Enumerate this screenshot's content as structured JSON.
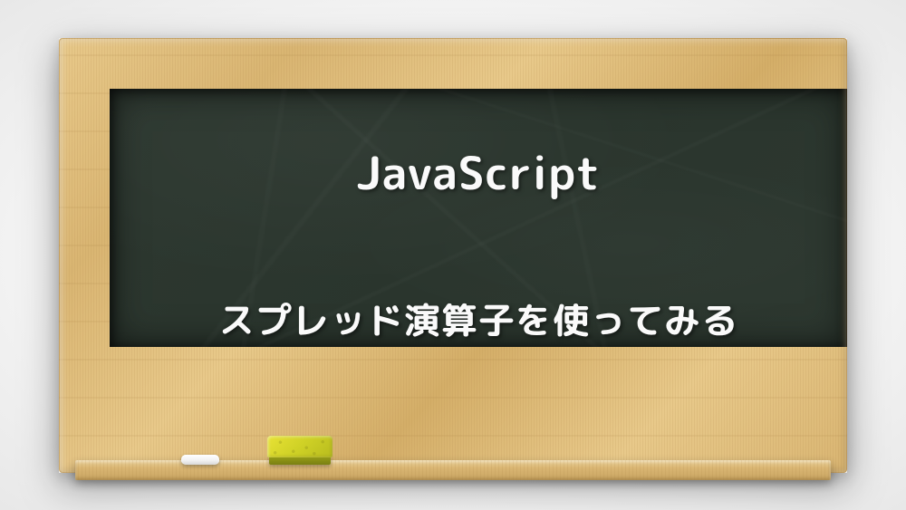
{
  "board": {
    "title": "JavaScript",
    "subtitle": "スプレッド演算子を使ってみる"
  },
  "props": {
    "chalk_name": "white-chalk",
    "eraser_name": "yellow-eraser"
  },
  "colors": {
    "board_bg": "#2d3830",
    "frame": "#d9b572",
    "text": "#fafafa",
    "eraser": "#cfd126",
    "chalk": "#ffffff"
  }
}
